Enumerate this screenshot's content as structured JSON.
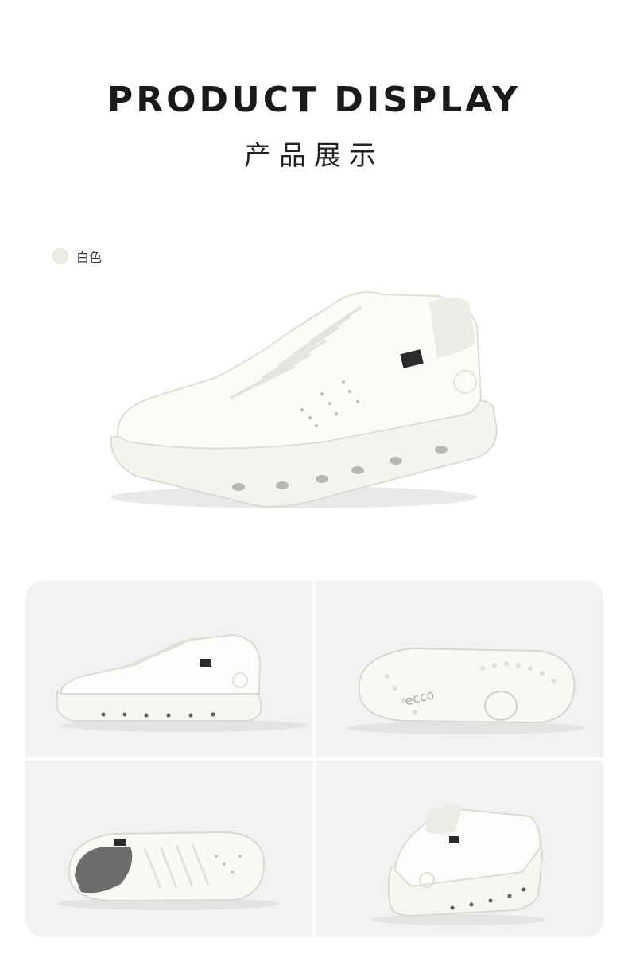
{
  "header": {
    "title_en": "PRODUCT DISPLAY",
    "title_cn": "产品展示"
  },
  "color_option": {
    "label": "白色",
    "swatch_color": "#ececE6"
  },
  "images": {
    "hero": "white-sneaker-hero",
    "grid": [
      "white-sneaker-side-view",
      "white-sneaker-sole-view",
      "white-sneaker-top-view",
      "white-sneaker-rear-view"
    ]
  },
  "sole_logo_text": "ecco"
}
